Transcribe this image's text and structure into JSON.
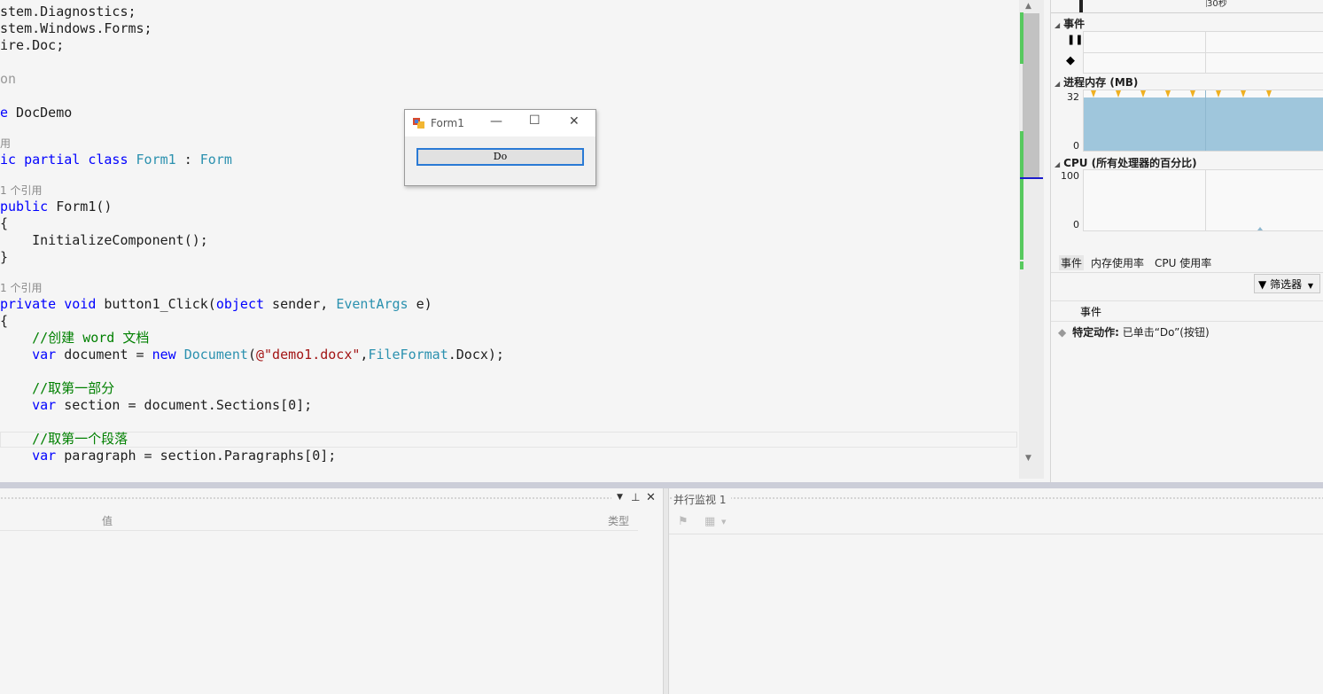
{
  "editor": {
    "lines": [
      "stem.Diagnostics;",
      "stem.Windows.Forms;",
      "ire.Doc;",
      "on",
      "e DocDemo",
      "ic partial class Form1 : Form",
      "public Form1()",
      "{",
      "    InitializeComponent();",
      "}",
      "private void button1_Click(object sender, EventArgs e)",
      "{",
      "    //创建 word 文档",
      "    var document = new Document(@\"demo1.docx\",FileFormat.Docx);",
      "    //取第一部分",
      "    var section = document.Sections[0];",
      "    //取第一个段落",
      "    var paragraph = section.Paragraphs[0];"
    ],
    "codelens": {
      "class": "用",
      "ctor": "1 个引用",
      "click": "1 个引用"
    }
  },
  "form1": {
    "title": "Form1",
    "button_label": "Do",
    "minimize": "—",
    "maximize": "☐",
    "close": "✕"
  },
  "diagnostics": {
    "timeline_label": "30秒",
    "events_title": "事件",
    "memory_title": "进程内存 (MB)",
    "memory_max": "32",
    "memory_min": "0",
    "memory_value_mb": 32,
    "cpu_title": "CPU (所有处理器的百分比)",
    "cpu_max": "100",
    "cpu_min": "0",
    "tabs": [
      "事件",
      "内存使用率",
      "CPU 使用率"
    ],
    "filter_label": "筛选器",
    "events_column": "事件",
    "event_row": {
      "bold": "特定动作:",
      "text": "已单击“Do”(按钮)"
    }
  },
  "locals": {
    "value_header": "值",
    "type_header": "类型"
  },
  "parallel_watch": {
    "title": "并行监视 1"
  },
  "colors": {
    "keyword": "#0000ff",
    "type": "#2b91af",
    "comment": "#008000",
    "string": "#a31515",
    "memory_fill": "#9fc6dc",
    "event_marker": "#f0b020"
  }
}
